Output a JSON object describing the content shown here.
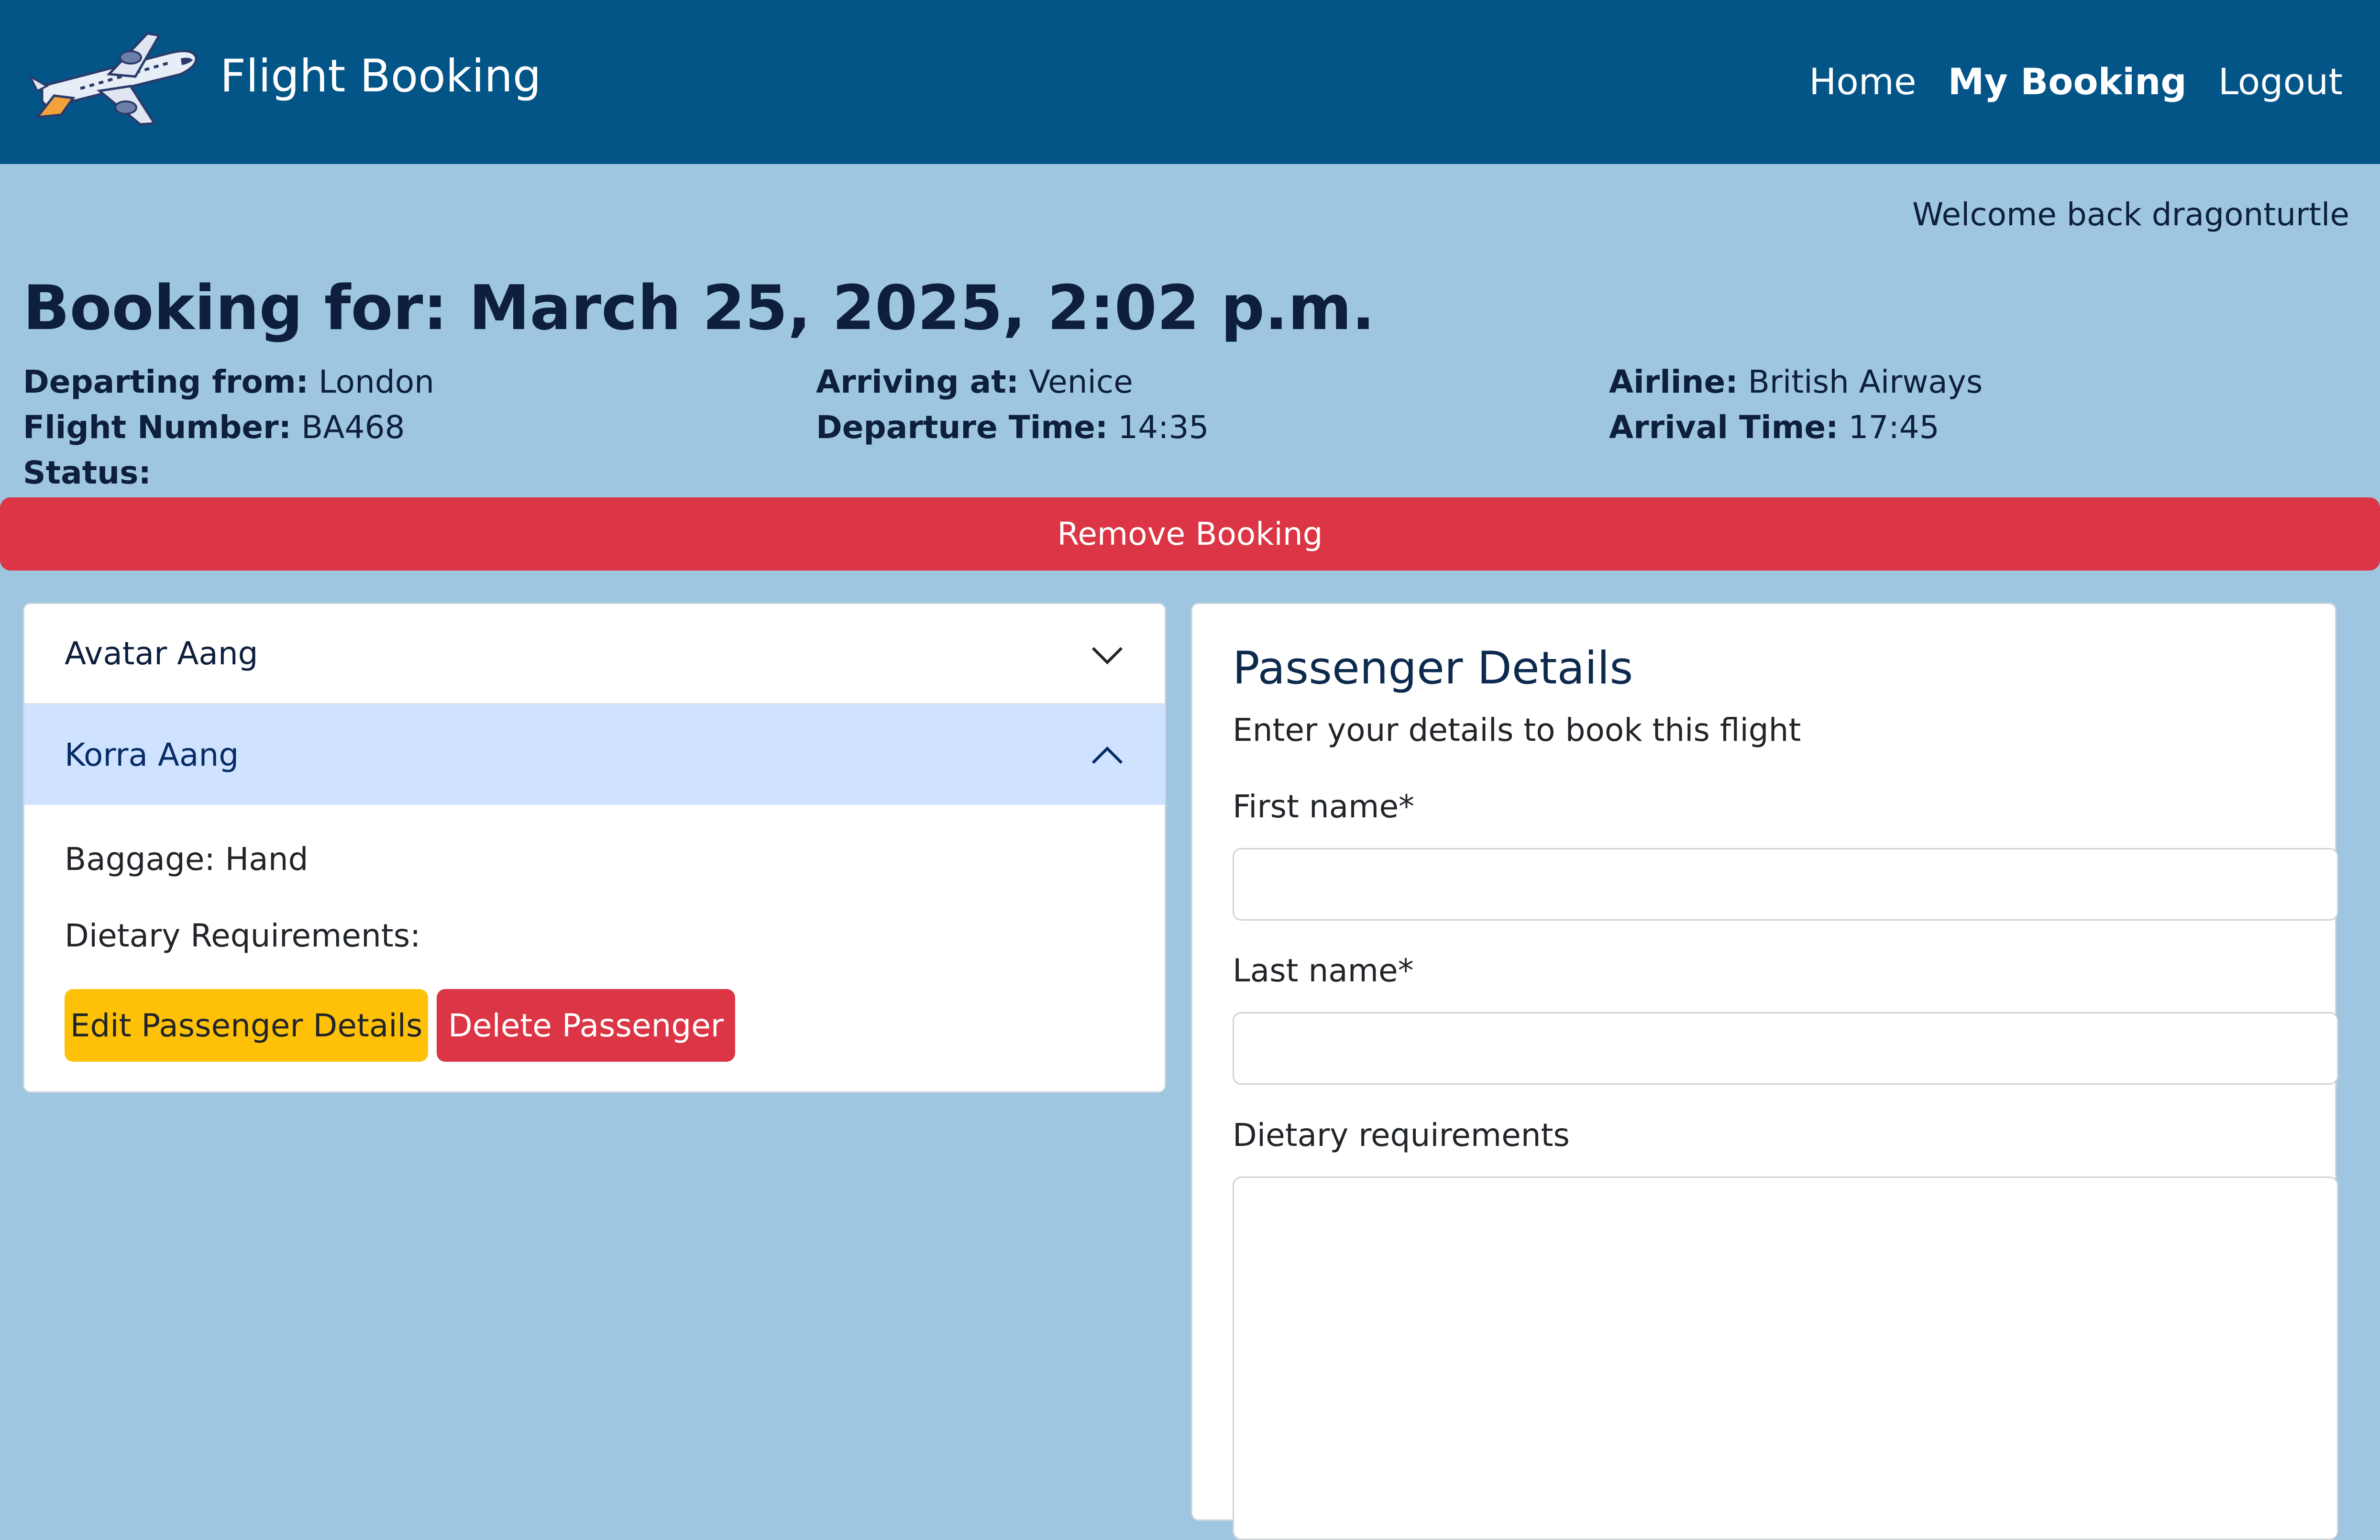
{
  "navbar": {
    "brand": "Flight Booking",
    "links": [
      "Home",
      "My Booking",
      "Logout"
    ]
  },
  "welcome": "Welcome back dragonturtle",
  "booking": {
    "title": "Booking for: March 25, 2025, 2:02 p.m.",
    "departing_label": "Departing from:",
    "departing_value": "London",
    "arriving_label": "Arriving at:",
    "arriving_value": "Venice",
    "airline_label": "Airline:",
    "airline_value": "British Airways",
    "flight_number_label": "Flight Number:",
    "flight_number_value": "BA468",
    "departure_time_label": "Departure Time:",
    "departure_time_value": "14:35",
    "arrival_time_label": "Arrival Time:",
    "arrival_time_value": "17:45",
    "status_label": "Status:",
    "status_value": "",
    "remove_label": "Remove Booking"
  },
  "passengers": [
    {
      "name": "Avatar Aang",
      "expanded": false
    },
    {
      "name": "Korra Aang",
      "expanded": true,
      "baggage": "Baggage: Hand",
      "dietary": "Dietary Requirements:",
      "edit_label": "Edit Passenger Details",
      "delete_label": "Delete Passenger"
    }
  ],
  "form": {
    "title": "Passenger Details",
    "subtitle": "Enter your details to book this flight",
    "first_name_label": "First name*",
    "first_name_value": "",
    "last_name_label": "Last name*",
    "last_name_value": "",
    "dietary_label": "Dietary requirements",
    "dietary_value": ""
  },
  "colors": {
    "navbar": "#035588",
    "page_background": "#9fc6e0",
    "danger": "#dc3545",
    "warning": "#ffc107",
    "accordion_active": "#cfe2ff"
  },
  "icons": [
    "airplane-logo-icon",
    "chevron-down-icon",
    "chevron-up-icon"
  ]
}
